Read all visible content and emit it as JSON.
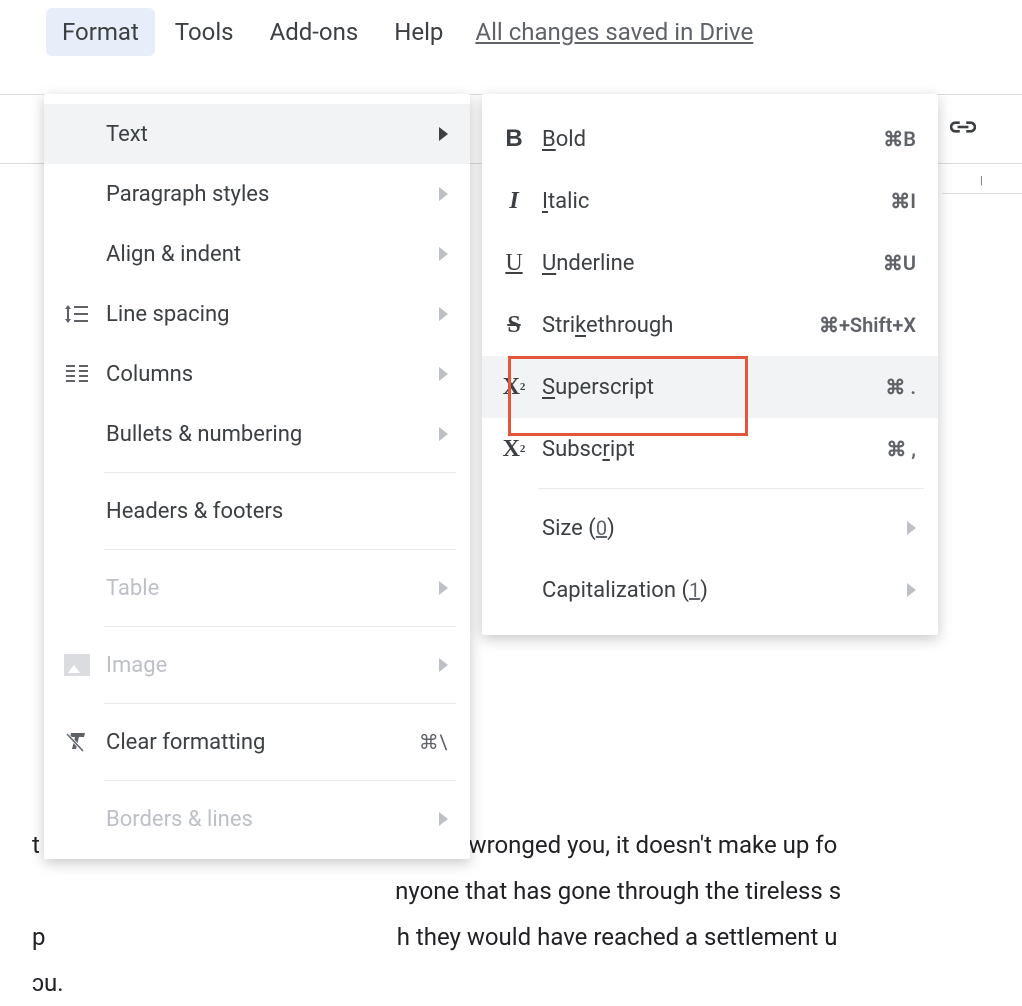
{
  "menubar": {
    "format": "Format",
    "tools": "Tools",
    "addons": "Add-ons",
    "help": "Help",
    "save_status": "All changes saved in Drive"
  },
  "format_menu": {
    "text": "Text",
    "paragraph_styles": "Paragraph styles",
    "align_indent": "Align & indent",
    "line_spacing": "Line spacing",
    "columns": "Columns",
    "bullets_numbering": "Bullets & numbering",
    "headers_footers": "Headers & footers",
    "table": "Table",
    "image": "Image",
    "clear_formatting": "Clear formatting",
    "clear_shortcut": "⌘\\",
    "borders_lines": "Borders & lines"
  },
  "text_submenu": {
    "bold": {
      "label_pre": "",
      "mn": "B",
      "label_post": "old",
      "shortcut": "⌘B"
    },
    "italic": {
      "label_pre": "",
      "mn": "I",
      "label_post": "talic",
      "shortcut": "⌘I"
    },
    "underline": {
      "label_pre": "",
      "mn": "U",
      "label_post": "nderline",
      "shortcut": "⌘U"
    },
    "strikethrough": {
      "label_pre": "Stri",
      "mn": "k",
      "label_post": "ethrough",
      "shortcut": "⌘+Shift+X"
    },
    "superscript": {
      "label_pre": "",
      "mn": "S",
      "label_post": "uperscript",
      "shortcut": "⌘ ."
    },
    "subscript": {
      "label_pre": "Subsc",
      "mn": "r",
      "label_post": "ipt",
      "shortcut": "⌘ ,"
    },
    "size": {
      "label": "Size",
      "badge": "0"
    },
    "capitalization": {
      "label": "Capitalization",
      "badge": "1"
    }
  },
  "document_snippet": {
    "line1": "t                                                           ho has wronged you, it doesn't make up fo",
    "line2": "                                                             nyone that has gone through the tireless s",
    "line3": "p                                                           h they would have reached a settlement u",
    "line4": "ɔu."
  }
}
